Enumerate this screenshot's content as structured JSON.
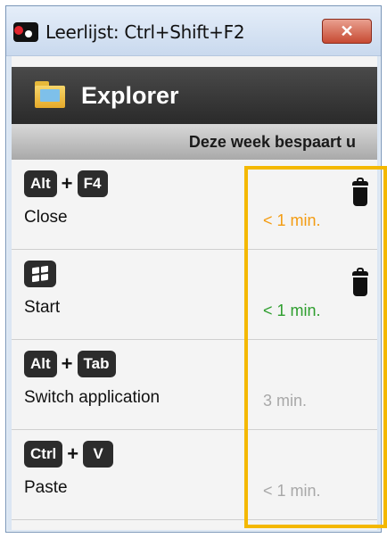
{
  "window": {
    "title": "Leerlijst: Ctrl+Shift+F2",
    "close_label": "✕"
  },
  "app": {
    "name": "Explorer",
    "icon": "folder-icon"
  },
  "savings_header": "Deze week bespaart u",
  "highlight_color": "#f4b800",
  "shortcuts": [
    {
      "keys": [
        "Alt",
        "F4"
      ],
      "label": "Close",
      "time": "< 1 min.",
      "time_color": "#f39c12",
      "has_delete": true
    },
    {
      "keys": [
        "windows-logo"
      ],
      "label": "Start",
      "time": "< 1 min.",
      "time_color": "#2e9e2e",
      "has_delete": true
    },
    {
      "keys": [
        "Alt",
        "Tab"
      ],
      "label": "Switch application",
      "time": "3 min.",
      "time_color": "#a8a8a8",
      "has_delete": false
    },
    {
      "keys": [
        "Ctrl",
        "V"
      ],
      "label": "Paste",
      "time": "< 1 min.",
      "time_color": "#a8a8a8",
      "has_delete": false
    }
  ],
  "plus_sign": "+"
}
